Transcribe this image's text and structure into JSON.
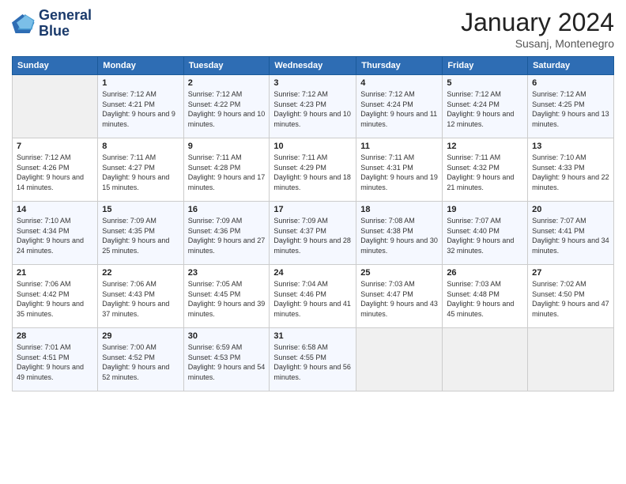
{
  "logo": {
    "line1": "General",
    "line2": "Blue"
  },
  "title": "January 2024",
  "subtitle": "Susanj, Montenegro",
  "weekdays": [
    "Sunday",
    "Monday",
    "Tuesday",
    "Wednesday",
    "Thursday",
    "Friday",
    "Saturday"
  ],
  "weeks": [
    [
      {
        "day": "",
        "sunrise": "",
        "sunset": "",
        "daylight": ""
      },
      {
        "day": "1",
        "sunrise": "Sunrise: 7:12 AM",
        "sunset": "Sunset: 4:21 PM",
        "daylight": "Daylight: 9 hours and 9 minutes."
      },
      {
        "day": "2",
        "sunrise": "Sunrise: 7:12 AM",
        "sunset": "Sunset: 4:22 PM",
        "daylight": "Daylight: 9 hours and 10 minutes."
      },
      {
        "day": "3",
        "sunrise": "Sunrise: 7:12 AM",
        "sunset": "Sunset: 4:23 PM",
        "daylight": "Daylight: 9 hours and 10 minutes."
      },
      {
        "day": "4",
        "sunrise": "Sunrise: 7:12 AM",
        "sunset": "Sunset: 4:24 PM",
        "daylight": "Daylight: 9 hours and 11 minutes."
      },
      {
        "day": "5",
        "sunrise": "Sunrise: 7:12 AM",
        "sunset": "Sunset: 4:24 PM",
        "daylight": "Daylight: 9 hours and 12 minutes."
      },
      {
        "day": "6",
        "sunrise": "Sunrise: 7:12 AM",
        "sunset": "Sunset: 4:25 PM",
        "daylight": "Daylight: 9 hours and 13 minutes."
      }
    ],
    [
      {
        "day": "7",
        "sunrise": "Sunrise: 7:12 AM",
        "sunset": "Sunset: 4:26 PM",
        "daylight": "Daylight: 9 hours and 14 minutes."
      },
      {
        "day": "8",
        "sunrise": "Sunrise: 7:11 AM",
        "sunset": "Sunset: 4:27 PM",
        "daylight": "Daylight: 9 hours and 15 minutes."
      },
      {
        "day": "9",
        "sunrise": "Sunrise: 7:11 AM",
        "sunset": "Sunset: 4:28 PM",
        "daylight": "Daylight: 9 hours and 17 minutes."
      },
      {
        "day": "10",
        "sunrise": "Sunrise: 7:11 AM",
        "sunset": "Sunset: 4:29 PM",
        "daylight": "Daylight: 9 hours and 18 minutes."
      },
      {
        "day": "11",
        "sunrise": "Sunrise: 7:11 AM",
        "sunset": "Sunset: 4:31 PM",
        "daylight": "Daylight: 9 hours and 19 minutes."
      },
      {
        "day": "12",
        "sunrise": "Sunrise: 7:11 AM",
        "sunset": "Sunset: 4:32 PM",
        "daylight": "Daylight: 9 hours and 21 minutes."
      },
      {
        "day": "13",
        "sunrise": "Sunrise: 7:10 AM",
        "sunset": "Sunset: 4:33 PM",
        "daylight": "Daylight: 9 hours and 22 minutes."
      }
    ],
    [
      {
        "day": "14",
        "sunrise": "Sunrise: 7:10 AM",
        "sunset": "Sunset: 4:34 PM",
        "daylight": "Daylight: 9 hours and 24 minutes."
      },
      {
        "day": "15",
        "sunrise": "Sunrise: 7:09 AM",
        "sunset": "Sunset: 4:35 PM",
        "daylight": "Daylight: 9 hours and 25 minutes."
      },
      {
        "day": "16",
        "sunrise": "Sunrise: 7:09 AM",
        "sunset": "Sunset: 4:36 PM",
        "daylight": "Daylight: 9 hours and 27 minutes."
      },
      {
        "day": "17",
        "sunrise": "Sunrise: 7:09 AM",
        "sunset": "Sunset: 4:37 PM",
        "daylight": "Daylight: 9 hours and 28 minutes."
      },
      {
        "day": "18",
        "sunrise": "Sunrise: 7:08 AM",
        "sunset": "Sunset: 4:38 PM",
        "daylight": "Daylight: 9 hours and 30 minutes."
      },
      {
        "day": "19",
        "sunrise": "Sunrise: 7:07 AM",
        "sunset": "Sunset: 4:40 PM",
        "daylight": "Daylight: 9 hours and 32 minutes."
      },
      {
        "day": "20",
        "sunrise": "Sunrise: 7:07 AM",
        "sunset": "Sunset: 4:41 PM",
        "daylight": "Daylight: 9 hours and 34 minutes."
      }
    ],
    [
      {
        "day": "21",
        "sunrise": "Sunrise: 7:06 AM",
        "sunset": "Sunset: 4:42 PM",
        "daylight": "Daylight: 9 hours and 35 minutes."
      },
      {
        "day": "22",
        "sunrise": "Sunrise: 7:06 AM",
        "sunset": "Sunset: 4:43 PM",
        "daylight": "Daylight: 9 hours and 37 minutes."
      },
      {
        "day": "23",
        "sunrise": "Sunrise: 7:05 AM",
        "sunset": "Sunset: 4:45 PM",
        "daylight": "Daylight: 9 hours and 39 minutes."
      },
      {
        "day": "24",
        "sunrise": "Sunrise: 7:04 AM",
        "sunset": "Sunset: 4:46 PM",
        "daylight": "Daylight: 9 hours and 41 minutes."
      },
      {
        "day": "25",
        "sunrise": "Sunrise: 7:03 AM",
        "sunset": "Sunset: 4:47 PM",
        "daylight": "Daylight: 9 hours and 43 minutes."
      },
      {
        "day": "26",
        "sunrise": "Sunrise: 7:03 AM",
        "sunset": "Sunset: 4:48 PM",
        "daylight": "Daylight: 9 hours and 45 minutes."
      },
      {
        "day": "27",
        "sunrise": "Sunrise: 7:02 AM",
        "sunset": "Sunset: 4:50 PM",
        "daylight": "Daylight: 9 hours and 47 minutes."
      }
    ],
    [
      {
        "day": "28",
        "sunrise": "Sunrise: 7:01 AM",
        "sunset": "Sunset: 4:51 PM",
        "daylight": "Daylight: 9 hours and 49 minutes."
      },
      {
        "day": "29",
        "sunrise": "Sunrise: 7:00 AM",
        "sunset": "Sunset: 4:52 PM",
        "daylight": "Daylight: 9 hours and 52 minutes."
      },
      {
        "day": "30",
        "sunrise": "Sunrise: 6:59 AM",
        "sunset": "Sunset: 4:53 PM",
        "daylight": "Daylight: 9 hours and 54 minutes."
      },
      {
        "day": "31",
        "sunrise": "Sunrise: 6:58 AM",
        "sunset": "Sunset: 4:55 PM",
        "daylight": "Daylight: 9 hours and 56 minutes."
      },
      {
        "day": "",
        "sunrise": "",
        "sunset": "",
        "daylight": ""
      },
      {
        "day": "",
        "sunrise": "",
        "sunset": "",
        "daylight": ""
      },
      {
        "day": "",
        "sunrise": "",
        "sunset": "",
        "daylight": ""
      }
    ]
  ]
}
